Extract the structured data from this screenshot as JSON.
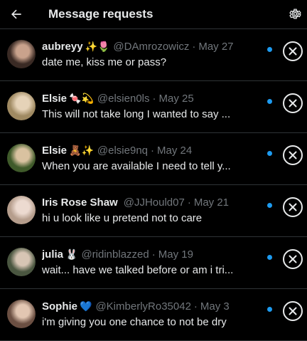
{
  "header": {
    "title": "Message requests",
    "back_icon": "arrow-left-icon",
    "settings_icon": "gear-icon"
  },
  "accent": "#1d9bf0",
  "requests": [
    {
      "name": "aubreyy",
      "emoji": "✨🌷",
      "handle": "@DAmrozowicz",
      "date": "May 27",
      "message": "date me, kiss me or pass?",
      "unread": true,
      "avatar_colors": [
        "#3a2a24",
        "#c9a28c"
      ]
    },
    {
      "name": "Elsie",
      "emoji": "🍬💫",
      "handle": "@elsien0ls",
      "date": "May 25",
      "message": "This will not take long I wanted to say ...",
      "unread": true,
      "avatar_colors": [
        "#a08a62",
        "#e6d3b8"
      ]
    },
    {
      "name": "Elsie",
      "emoji": "🧸✨",
      "handle": "@elsie9nq",
      "date": "May 24",
      "message": "When you are available I need to tell y...",
      "unread": true,
      "avatar_colors": [
        "#3f5a2a",
        "#d9c2a0"
      ]
    },
    {
      "name": "Iris Rose Shaw",
      "emoji": "",
      "handle": "@JJHould07",
      "date": "May 21",
      "message": "hi u look like u pretend not to care",
      "unread": true,
      "avatar_colors": [
        "#b59d8c",
        "#ecdad0"
      ]
    },
    {
      "name": "julia",
      "emoji": "🐰",
      "handle": "@ridinblazzed",
      "date": "May 19",
      "message": "wait... have we talked before or am i tri...",
      "unread": true,
      "avatar_colors": [
        "#4a5640",
        "#d7c5b4"
      ]
    },
    {
      "name": "Sophie",
      "emoji": "💙",
      "handle": "@KimberlyRo35042",
      "date": "May 3",
      "message": "i'm giving you one chance to not be dry",
      "unread": true,
      "avatar_colors": [
        "#6b4f42",
        "#e2c6b2"
      ]
    }
  ]
}
